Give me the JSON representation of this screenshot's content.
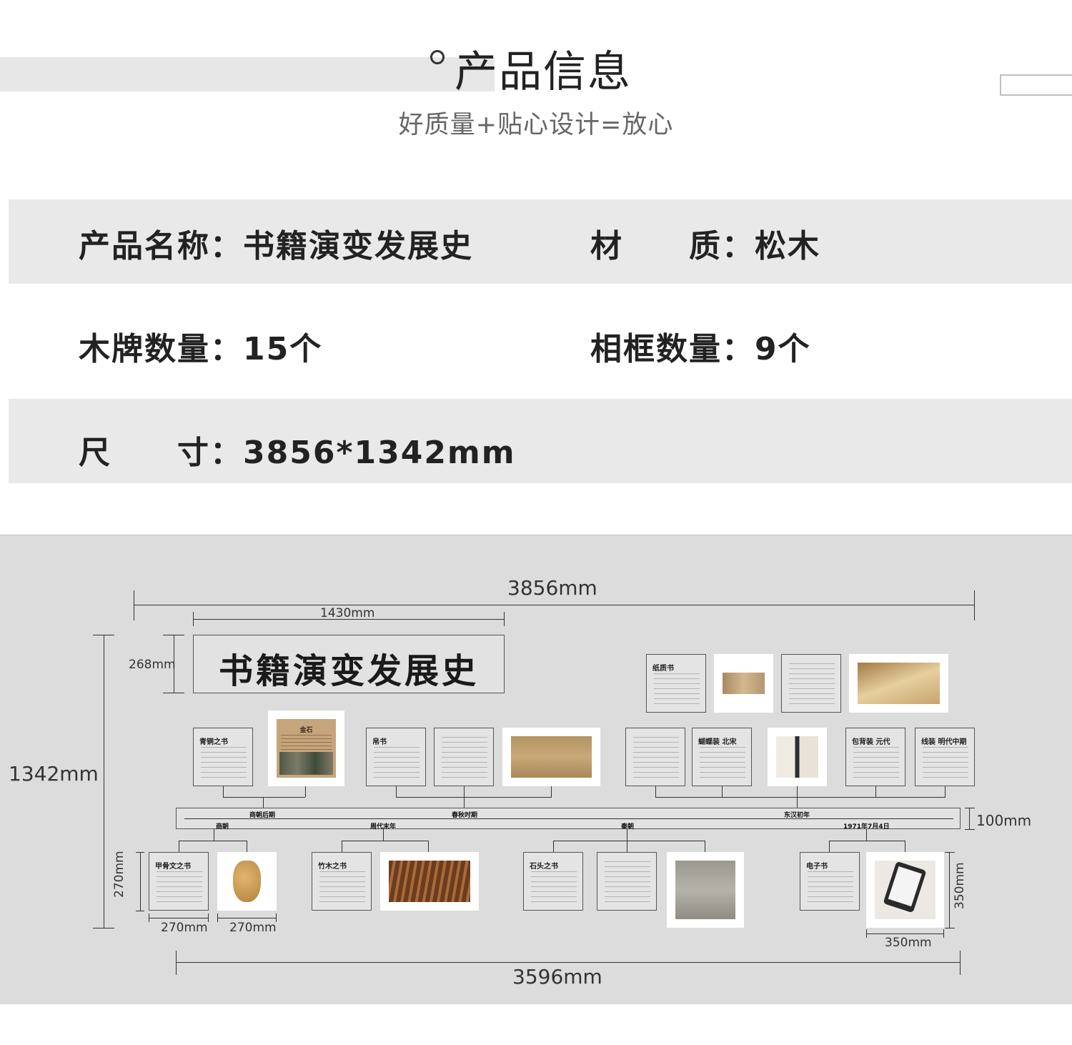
{
  "header": {
    "title": "产品信息",
    "subtitle": "好质量+贴心设计=放心"
  },
  "info": {
    "name_label": "产品名称：",
    "name_value": "书籍演变发展史",
    "material_label": "材　　质：",
    "material_value": "松木",
    "boards_label": "木牌数量：",
    "boards_value": "15个",
    "frames_label": "相框数量：",
    "frames_value": "9个",
    "size_label": "尺　　寸：",
    "size_value": "3856*1342mm"
  },
  "diagram": {
    "title": "书籍演变发展史",
    "dims": {
      "total_width": "3856mm",
      "title_width": "1430mm",
      "title_height": "268mm",
      "total_height": "1342mm",
      "bar_height": "100mm",
      "card_height": "270mm",
      "card_w1": "270mm",
      "card_w2": "270mm",
      "frame_height": "350mm",
      "frame_width": "350mm",
      "bottom_width": "3596mm"
    },
    "top_eras": [
      "商朝后期",
      "春秋时期",
      "东汉初年"
    ],
    "bottom_eras": [
      "商朝",
      "周代末年",
      "秦朝",
      "1971年7月4日"
    ],
    "cards": {
      "bronze": "青铜之书",
      "silk": "帛书",
      "paper": "纸质书",
      "butterfly": "蝴蝶装 北宋",
      "wrapback": "包背装 元代",
      "thread": "线装 明代中期",
      "oracle": "甲骨文之书",
      "bamboo": "竹木之书",
      "stone": "石头之书",
      "ebook": "电子书"
    },
    "jinshi": "金石"
  }
}
